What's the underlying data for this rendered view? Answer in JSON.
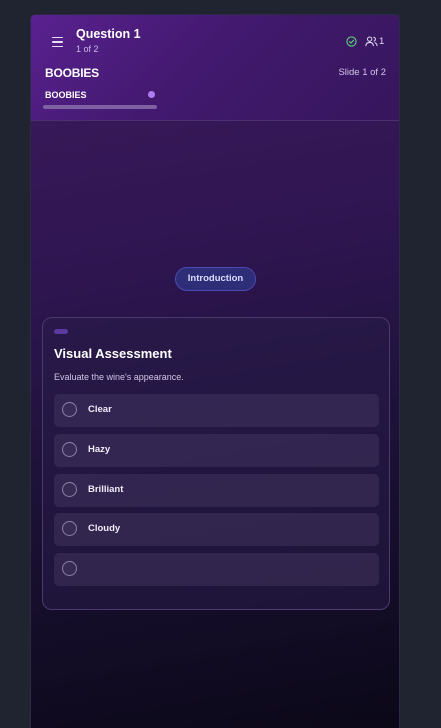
{
  "header": {
    "question_title": "Question 1",
    "question_sub": "1 of 2",
    "status_icon": "check-circle-icon",
    "users_icon": "users-icon",
    "users_count": "1",
    "deck_title": "BOOBIES",
    "slide_count": "Slide 1 of 2",
    "tabs": [
      {
        "label": "BOOBIES",
        "active": true
      }
    ]
  },
  "section_pill": "Introduction",
  "card": {
    "title": "Visual Assessment",
    "description": "Evaluate the wine's appearance.",
    "options": [
      {
        "label": "Clear"
      },
      {
        "label": "Hazy"
      },
      {
        "label": "Brilliant"
      },
      {
        "label": "Cloudy"
      },
      {
        "label": ""
      }
    ]
  },
  "colors": {
    "accent_purple": "#5a2190",
    "tab_dot": "#b07cf2",
    "pill_bg": "#2d2d78",
    "status_green": "#5bd37a"
  }
}
